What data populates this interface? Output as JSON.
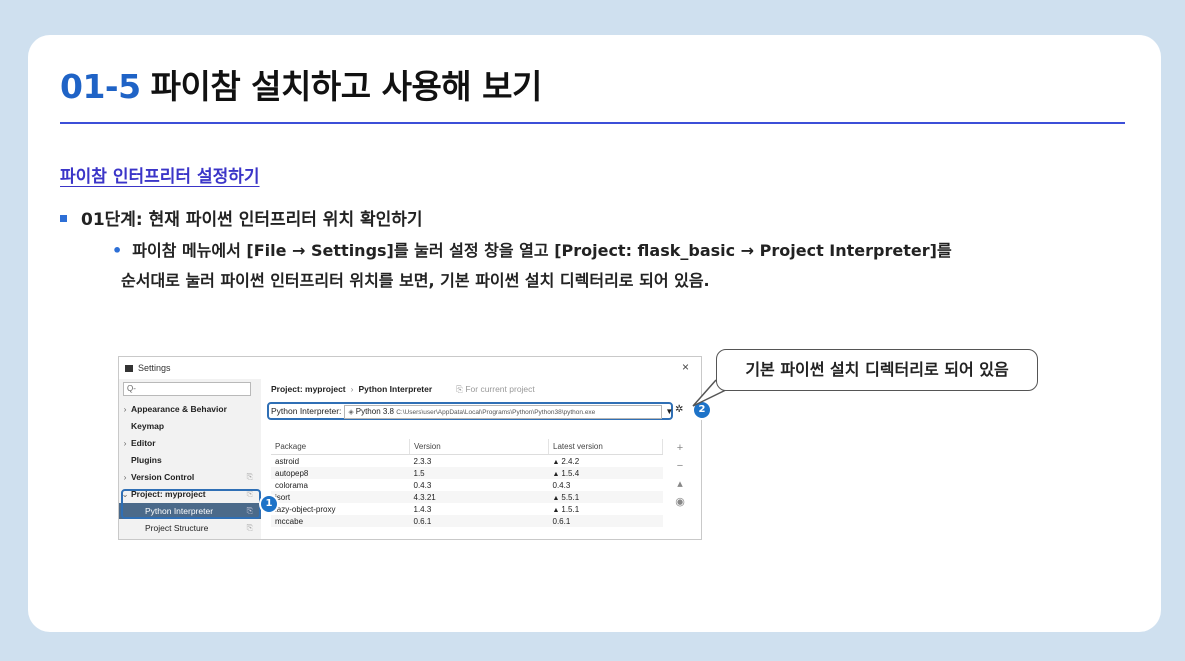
{
  "slide": {
    "section_number": "01-5",
    "title": "파이참 설치하고 사용해 보기",
    "subheading": "파이참 인터프리터 설정하기",
    "step": "01단계: 현재 파이썬 인터프리터 위치 확인하기",
    "desc_line1": "파이참 메뉴에서 [File → Settings]를 눌러 설정 창을 열고 [Project: flask_basic → Project Interpreter]를",
    "desc_line2": "순서대로 눌러 파이썬 인터프리터 위치를 보면, 기본 파이썬 설치 디렉터리로 되어 있음.",
    "callout": "기본 파이썬 설치 디렉터리로 되어 있음",
    "markers": [
      "1",
      "2"
    ],
    "accent_color": "#1f63c6"
  },
  "settings_window": {
    "title": "Settings",
    "close": "×",
    "search_placeholder": "Q-",
    "sidebar": [
      {
        "label": "Appearance & Behavior",
        "arrow": "›"
      },
      {
        "label": "Keymap",
        "arrow": ""
      },
      {
        "label": "Editor",
        "arrow": "›"
      },
      {
        "label": "Plugins",
        "arrow": ""
      },
      {
        "label": "Version Control",
        "arrow": "›"
      },
      {
        "label": "Project: myproject",
        "arrow": "⌄"
      },
      {
        "label": "Python Interpreter",
        "arrow": ""
      },
      {
        "label": "Project Structure",
        "arrow": ""
      }
    ],
    "breadcrumb_project": "Project: myproject",
    "breadcrumb_sep": "›",
    "breadcrumb_page": "Python Interpreter",
    "breadcrumb_hint": "⎘ For current project",
    "interpreter_label": "Python Interpreter:",
    "interpreter_name": "Python 3.8",
    "interpreter_path": "C:\\Users\\user\\AppData\\Local\\Programs\\Python\\Python38\\python.exe",
    "table_headers": [
      "Package",
      "Version",
      "Latest version"
    ],
    "packages": [
      {
        "name": "astroid",
        "version": "2.3.3",
        "latest": "2.4.2",
        "upgrade": true
      },
      {
        "name": "autopep8",
        "version": "1.5",
        "latest": "1.5.4",
        "upgrade": true
      },
      {
        "name": "colorama",
        "version": "0.4.3",
        "latest": "0.4.3",
        "upgrade": false
      },
      {
        "name": "isort",
        "version": "4.3.21",
        "latest": "5.5.1",
        "upgrade": true
      },
      {
        "name": "lazy-object-proxy",
        "version": "1.4.3",
        "latest": "1.5.1",
        "upgrade": true
      },
      {
        "name": "mccabe",
        "version": "0.6.1",
        "latest": "0.6.1",
        "upgrade": false
      }
    ]
  }
}
